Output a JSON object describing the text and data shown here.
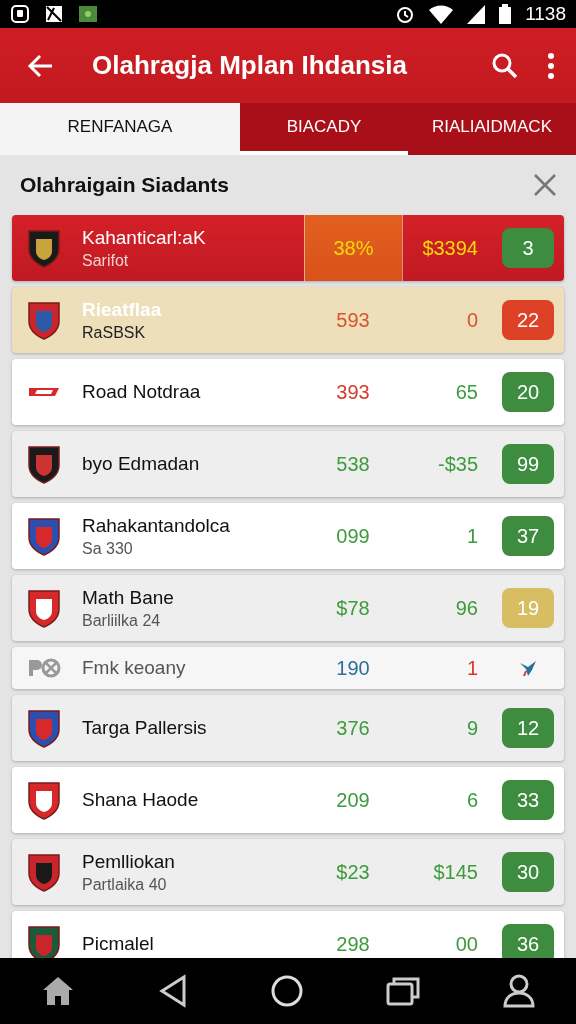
{
  "status_bar": {
    "time": "1138"
  },
  "app_bar": {
    "title": "Olahragja Mplan Ihdansia"
  },
  "tabs": [
    {
      "label": "RENFANAGA",
      "selected": true,
      "indicator": false
    },
    {
      "label": "BIACADY",
      "selected": false,
      "indicator": true
    },
    {
      "label": "RIALIAIDMACK",
      "selected": false,
      "indicator": false
    }
  ],
  "section": {
    "title": "Olahraigain Siadants"
  },
  "rows": [
    {
      "kind": "leader",
      "name": "Kahanticarl:aK",
      "subtitle": "Sarifot",
      "value": {
        "text": "38%",
        "color": "#f5d90a"
      },
      "change": {
        "text": "$3394",
        "color": "#f5d90a"
      },
      "badge": "3",
      "color": "#3d8c40"
    },
    {
      "kind": "featured",
      "name": "Rieatflaa",
      "subtitle": "RaSBSK",
      "value": {
        "text": "593",
        "color": "#d9532b"
      },
      "change": {
        "text": "0",
        "color": "#d9532b"
      },
      "badge": "22",
      "color": "#dd4227"
    },
    {
      "kind": "plain",
      "name": "Road Notdraa",
      "value": {
        "text": "393",
        "color": "#d33a2c"
      },
      "change": {
        "text": "65",
        "color": "#3d9a3d"
      },
      "badge": "20",
      "color": "#3d8c40"
    },
    {
      "kind": "grey",
      "name": "byo Edmadan",
      "value": {
        "text": "538",
        "color": "#3d9a3d"
      },
      "change": {
        "text": "-$35",
        "color": "#3d9a3d"
      },
      "badge": "99",
      "color": "#3d8c40"
    },
    {
      "kind": "plain",
      "name": "Rahakantandolca",
      "subtitle": "Sa 330",
      "value": {
        "text": "099",
        "color": "#3d9a3d"
      },
      "change": {
        "text": "1",
        "color": "#3d9a3d"
      },
      "badge": "37",
      "color": "#3d8c40"
    },
    {
      "kind": "grey",
      "name": "Math Bane",
      "subtitle": "Barliilka 24",
      "value": {
        "text": "$78",
        "color": "#3d9a3d"
      },
      "change": {
        "text": "96",
        "color": "#3d9a3d"
      },
      "badge": "19",
      "color": "#d9bd62"
    },
    {
      "kind": "compact",
      "name": "Fmk keoany",
      "value": {
        "text": "190",
        "color": "#2b6f9e"
      },
      "change": {
        "text": "1",
        "color": "#d33a2c"
      }
    },
    {
      "kind": "grey",
      "name": "Targa Pallersis",
      "value": {
        "text": "376",
        "color": "#3d9a3d"
      },
      "change": {
        "text": "9",
        "color": "#3d9a3d"
      },
      "badge": "12",
      "color": "#3d8c40"
    },
    {
      "kind": "plain",
      "name": "Shana Haode",
      "value": {
        "text": "209",
        "color": "#3d9a3d"
      },
      "change": {
        "text": "6",
        "color": "#3d9a3d"
      },
      "badge": "33",
      "color": "#3d8c40"
    },
    {
      "kind": "grey",
      "name": "Pemlliokan",
      "subtitle": "Partlaika 40",
      "value": {
        "text": "$23",
        "color": "#3d9a3d"
      },
      "change": {
        "text": "$145",
        "color": "#3d9a3d"
      },
      "badge": "30",
      "color": "#3d8c40"
    },
    {
      "kind": "plain",
      "name": "Picmalel",
      "value": {
        "text": "298",
        "color": "#3d9a3d"
      },
      "change": {
        "text": "00",
        "color": "#3d9a3d"
      },
      "badge": "36",
      "color": "#3d8c40"
    }
  ]
}
